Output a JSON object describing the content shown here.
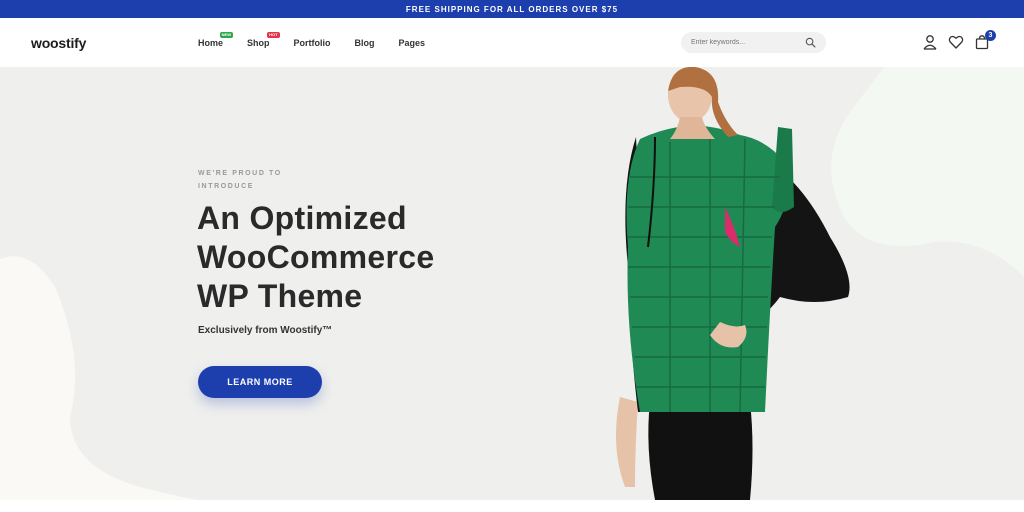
{
  "topbar": {
    "text": "FREE SHIPPING FOR ALL ORDERS OVER $75"
  },
  "header": {
    "logo": "woostify",
    "nav": [
      {
        "label": "Home",
        "badge": "NEW"
      },
      {
        "label": "Shop",
        "badge": "HOT"
      },
      {
        "label": "Portfolio"
      },
      {
        "label": "Blog"
      },
      {
        "label": "Pages"
      }
    ],
    "search_placeholder": "Enter keywords...",
    "cart_count": "3"
  },
  "hero": {
    "eyebrow": "WE'RE PROUD TO INTRODUCE",
    "headline_line1": "An Optimized",
    "headline_line2": "WooCommerce",
    "headline_line3": "WP Theme",
    "subheading": "Exclusively from Woostify™",
    "cta_label": "LEARN MORE"
  },
  "colors": {
    "brand": "#1d3fae",
    "vest": "#1f8a54",
    "hero_bg": "#efefee"
  }
}
